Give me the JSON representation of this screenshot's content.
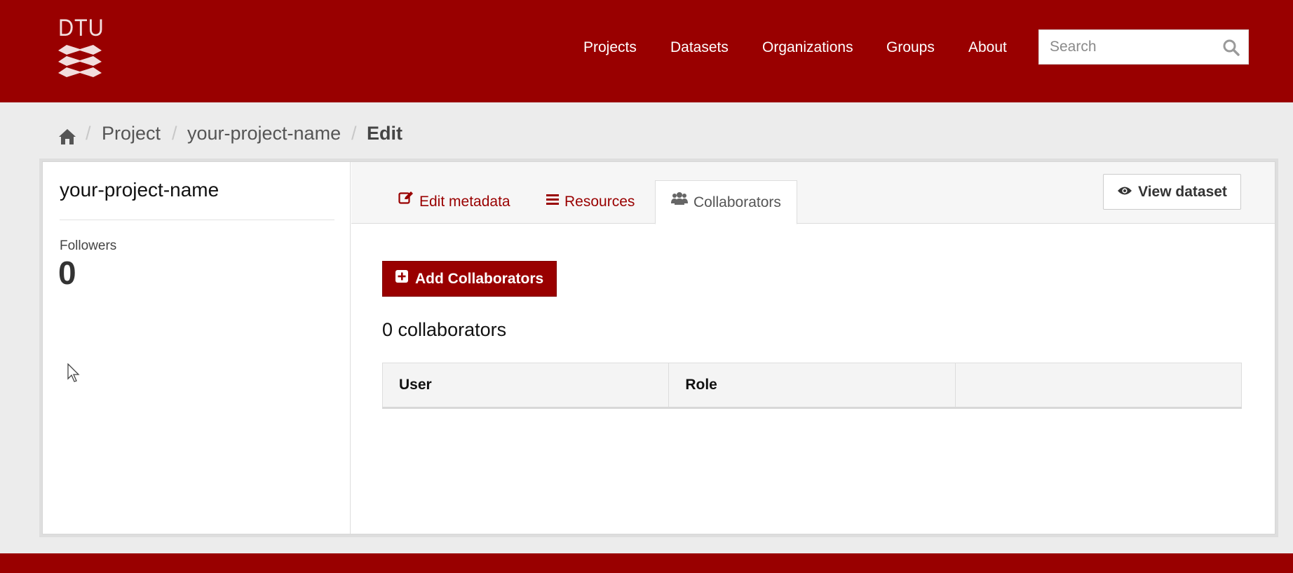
{
  "header": {
    "logo_text": "DTU",
    "nav": [
      {
        "label": "Projects"
      },
      {
        "label": "Datasets"
      },
      {
        "label": "Organizations"
      },
      {
        "label": "Groups"
      },
      {
        "label": "About"
      }
    ],
    "search_placeholder": "Search",
    "search_icon": "search-icon"
  },
  "breadcrumb": {
    "home_icon": "home-icon",
    "items": [
      "Project",
      "your-project-name",
      "Edit"
    ],
    "separator": "/"
  },
  "sidebar": {
    "title": "your-project-name",
    "followers_label": "Followers",
    "followers_count": "0"
  },
  "tabs": [
    {
      "label": "Edit metadata",
      "icon": "edit-icon"
    },
    {
      "label": "Resources",
      "icon": "list-icon"
    },
    {
      "label": "Collaborators",
      "icon": "users-icon",
      "active": true
    }
  ],
  "view_button": {
    "label": "View dataset",
    "icon": "eye-icon"
  },
  "add_button": {
    "label": "Add Collaborators",
    "icon": "plus-square-icon"
  },
  "collaborators": {
    "count_text": "0 collaborators",
    "columns": [
      "User",
      "Role",
      ""
    ]
  },
  "colors": {
    "brand": "#990000",
    "page_bg": "#ececec"
  }
}
